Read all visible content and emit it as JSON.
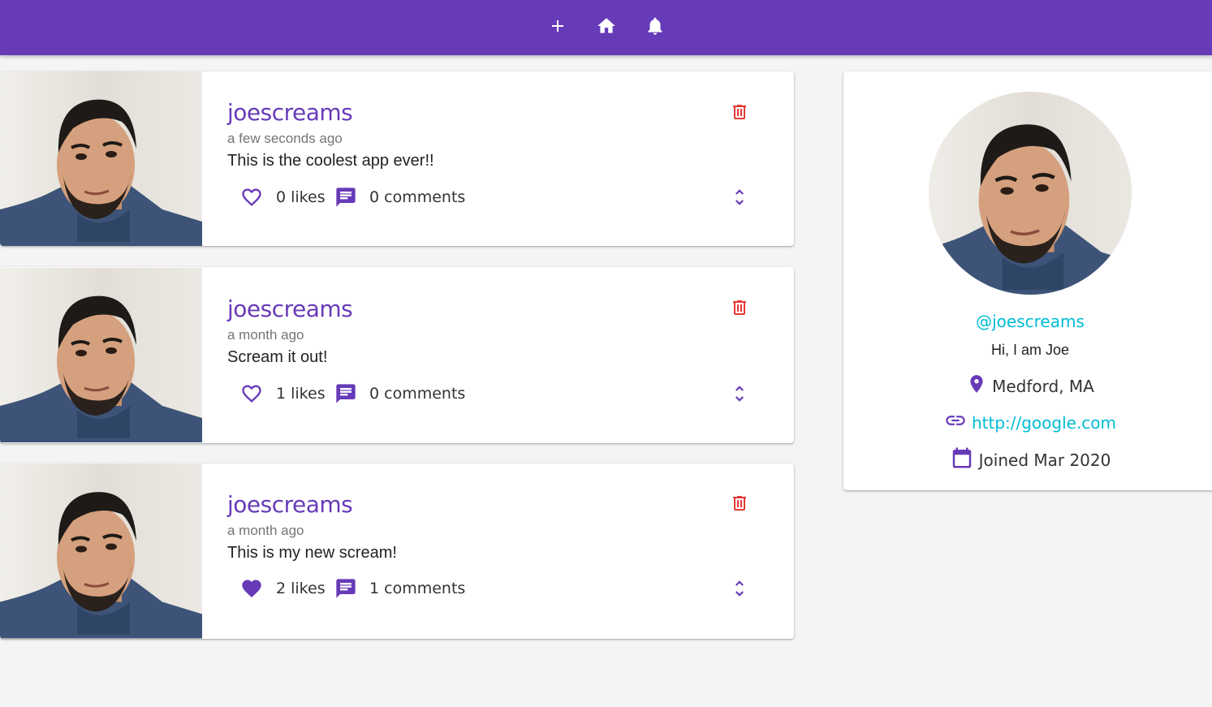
{
  "navbar": {
    "icons": [
      "plus-icon",
      "home-icon",
      "notifications-icon"
    ]
  },
  "colors": {
    "primary": "#673ab7",
    "accent": "#00bcd4",
    "danger": "#e53935",
    "background": "#f4f4f4"
  },
  "posts": [
    {
      "username": "joescreams",
      "time": "a few seconds ago",
      "body": "This is the coolest app ever!!",
      "likes": "0 likes",
      "comments": "0 comments",
      "liked": false
    },
    {
      "username": "joescreams",
      "time": "a month ago",
      "body": "Scream it out!",
      "likes": "1 likes",
      "comments": "0 comments",
      "liked": false
    },
    {
      "username": "joescreams",
      "time": "a month ago",
      "body": "This is my new scream!",
      "likes": "2 likes",
      "comments": "1 comments",
      "liked": true
    }
  ],
  "profile": {
    "handle": "@joescreams",
    "bio": "Hi, I am Joe",
    "location": "Medford, MA",
    "website": "http://google.com",
    "joined": "Joined Mar 2020"
  }
}
